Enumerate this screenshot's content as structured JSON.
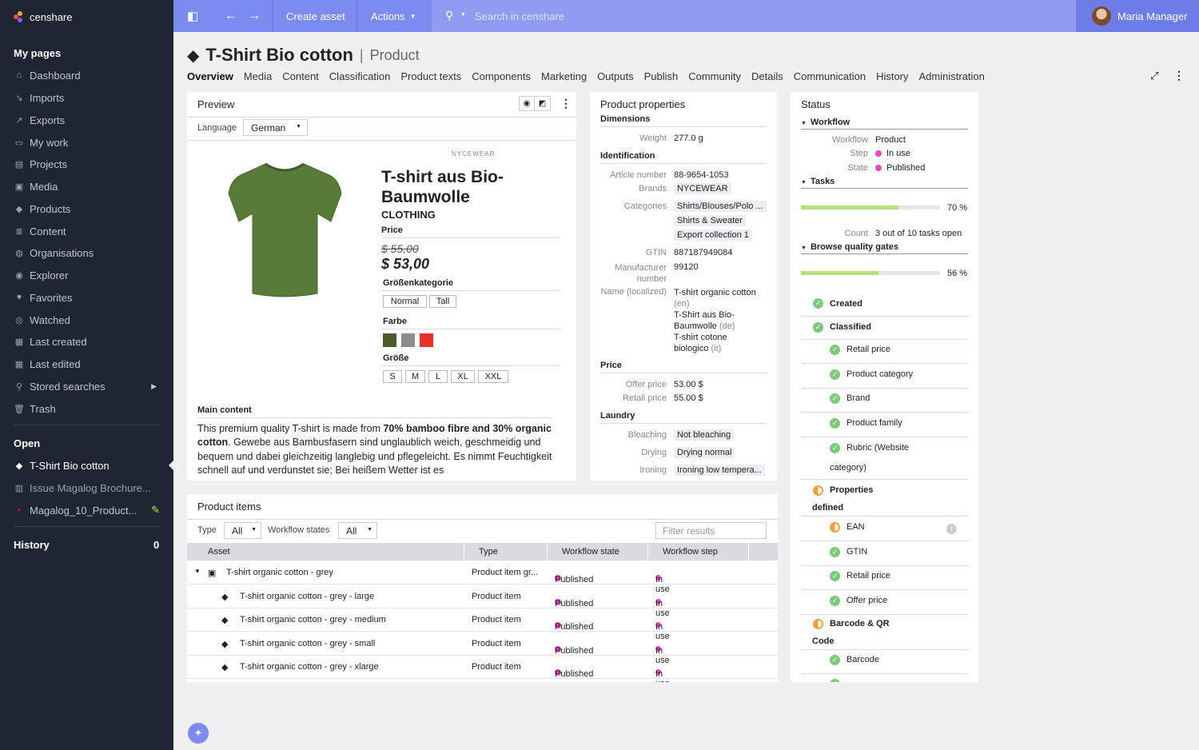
{
  "app": {
    "brand": "censhare"
  },
  "sidebar": {
    "my_pages_heading": "My pages",
    "items": [
      {
        "label": "Dashboard",
        "icon": "home-icon"
      },
      {
        "label": "Imports",
        "icon": "import-icon"
      },
      {
        "label": "Exports",
        "icon": "export-icon"
      },
      {
        "label": "My work",
        "icon": "chat-icon"
      },
      {
        "label": "Projects",
        "icon": "project-icon"
      },
      {
        "label": "Media",
        "icon": "image-icon"
      },
      {
        "label": "Products",
        "icon": "box-icon"
      },
      {
        "label": "Content",
        "icon": "document-icon"
      },
      {
        "label": "Organisations",
        "icon": "globe-icon"
      },
      {
        "label": "Explorer",
        "icon": "compass-icon"
      },
      {
        "label": "Favorites",
        "icon": "heart-icon"
      },
      {
        "label": "Watched",
        "icon": "eye-icon"
      },
      {
        "label": "Last created",
        "icon": "doc-plus-icon"
      },
      {
        "label": "Last edited",
        "icon": "doc-edit-icon"
      },
      {
        "label": "Stored searches",
        "icon": "search-icon"
      },
      {
        "label": "Trash",
        "icon": "trash-icon"
      }
    ],
    "open_heading": "Open",
    "open_items": [
      {
        "label": "T-Shirt Bio cotton"
      },
      {
        "label": "Issue Magalog Brochure..."
      },
      {
        "label": "Magalog_10_Product..."
      }
    ],
    "history_heading": "History",
    "history_count": "0"
  },
  "topbar": {
    "create_asset": "Create asset",
    "actions": "Actions",
    "search_placeholder": "Search in censhare",
    "user_name": "Maria Manager"
  },
  "page": {
    "title": "T-Shirt Bio cotton",
    "subtitle": "Product",
    "tabs": [
      "Overview",
      "Media",
      "Content",
      "Classification",
      "Product texts",
      "Components",
      "Marketing",
      "Outputs",
      "Publish",
      "Community",
      "Details",
      "Communication",
      "History",
      "Administration"
    ]
  },
  "preview": {
    "title": "Preview",
    "language_label": "Language",
    "language_value": "German",
    "brand_mark": "NYCEWEAR",
    "product_name": "T-shirt aus Bio-Baumwolle",
    "category": "CLOTHING",
    "price_label": "Price",
    "old_price": "$ 55,00",
    "new_price": "$ 53,00",
    "size_category_label": "Größenkategorie",
    "size_categories": [
      "Normal",
      "Tall"
    ],
    "color_label": "Farbe",
    "colors": [
      "#4b5a2a",
      "#8c8c8c",
      "#e8302a"
    ],
    "size_label": "Größe",
    "sizes": [
      "S",
      "M",
      "L",
      "XL",
      "XXL"
    ],
    "main_content_label": "Main content",
    "main_text_1": "This premium quality T-shirt is made from ",
    "main_text_bold": "70% bamboo fibre and 30% organic cotton",
    "main_text_2": ". Gewebe aus Bambusfasern sind unglaublich weich, geschmeidig und bequem und dabei gleichzeitig langlebig und pflegeleicht. Es nimmt Feuchtigkeit schnell auf und verdunstet sie; Bei heißem Wetter ist es"
  },
  "props": {
    "title": "Product properties",
    "dimensions": "Dimensions",
    "weight_label": "Weight",
    "weight": "277.0 g",
    "identification": "Identification",
    "article_label": "Article number",
    "article": "88-9654-1053",
    "brands_label": "Brands",
    "brand": "NYCEWEAR",
    "categories_label": "Categories",
    "categories": [
      "Shirts/Blouses/Polo ...",
      "Shirts & Sweater",
      "Export collection 1"
    ],
    "gtin_label": "GTIN",
    "gtin": "887187949084",
    "manufacturer_label": "Manufacturer number",
    "manufacturer": "99120",
    "name_label": "Name (localized)",
    "names": [
      "T-shirt organic cotton",
      "(en)",
      "T-Shirt aus Bio-",
      "Baumwolle",
      "(de)",
      "T-shirt cotone",
      "biologico",
      "(it)"
    ],
    "price": "Price",
    "offer_label": "Offer price",
    "offer": "53.00 $",
    "retail_label": "Retail price",
    "retail": "55.00 $",
    "laundry": "Laundry",
    "bleaching_label": "Bleaching",
    "bleaching": "Not bleaching",
    "drying_label": "Drying",
    "drying": "Drying normal",
    "ironing_label": "Ironing",
    "ironing": "Ironing low tempera..."
  },
  "status": {
    "title": "Status",
    "workflow_heading": "Workflow",
    "workflow_label": "Workflow",
    "workflow": "Product",
    "step_label": "Step",
    "step": "In use",
    "state_label": "State",
    "state": "Published",
    "tasks_heading": "Tasks",
    "tasks_progress": 0.7,
    "tasks_percent": "70 %",
    "count_label": "Count",
    "count": "3 out of 10 tasks open",
    "quality_heading": "Browse quality gates",
    "quality_progress": 0.56,
    "quality_percent": "56 %",
    "gates": [
      "Created",
      "Classified",
      "Retail price",
      "Product category",
      "Brand",
      "Product family",
      "Rubric (Website",
      "category)",
      "Properties",
      "defined",
      "EAN",
      "GTIN",
      "Retail price",
      "Offer price",
      "Barcode & QR",
      "Code",
      "Barcode"
    ]
  },
  "items": {
    "title": "Product items",
    "type_label": "Type",
    "type_value": "All",
    "wf_label": "Workflow states",
    "wf_value": "All",
    "filter_placeholder": "Filter results",
    "columns": [
      "Asset",
      "Type",
      "Workflow state",
      "Workflow step"
    ],
    "rows": [
      {
        "asset": "T-shirt organic cotton - grey",
        "type": "Product item gr...",
        "state": "Published",
        "step": "In use"
      },
      {
        "asset": "T-shirt organic cotton - grey - large",
        "type": "Product item",
        "state": "Published",
        "step": "In use"
      },
      {
        "asset": "T-shirt organic cotton - grey - medium",
        "type": "Product item",
        "state": "Published",
        "step": "In use"
      },
      {
        "asset": "T-shirt organic cotton - grey - small",
        "type": "Product item",
        "state": "Published",
        "step": "In use"
      },
      {
        "asset": "T-shirt organic cotton - grey - xlarge",
        "type": "Product item",
        "state": "Published",
        "step": "In use"
      }
    ]
  }
}
